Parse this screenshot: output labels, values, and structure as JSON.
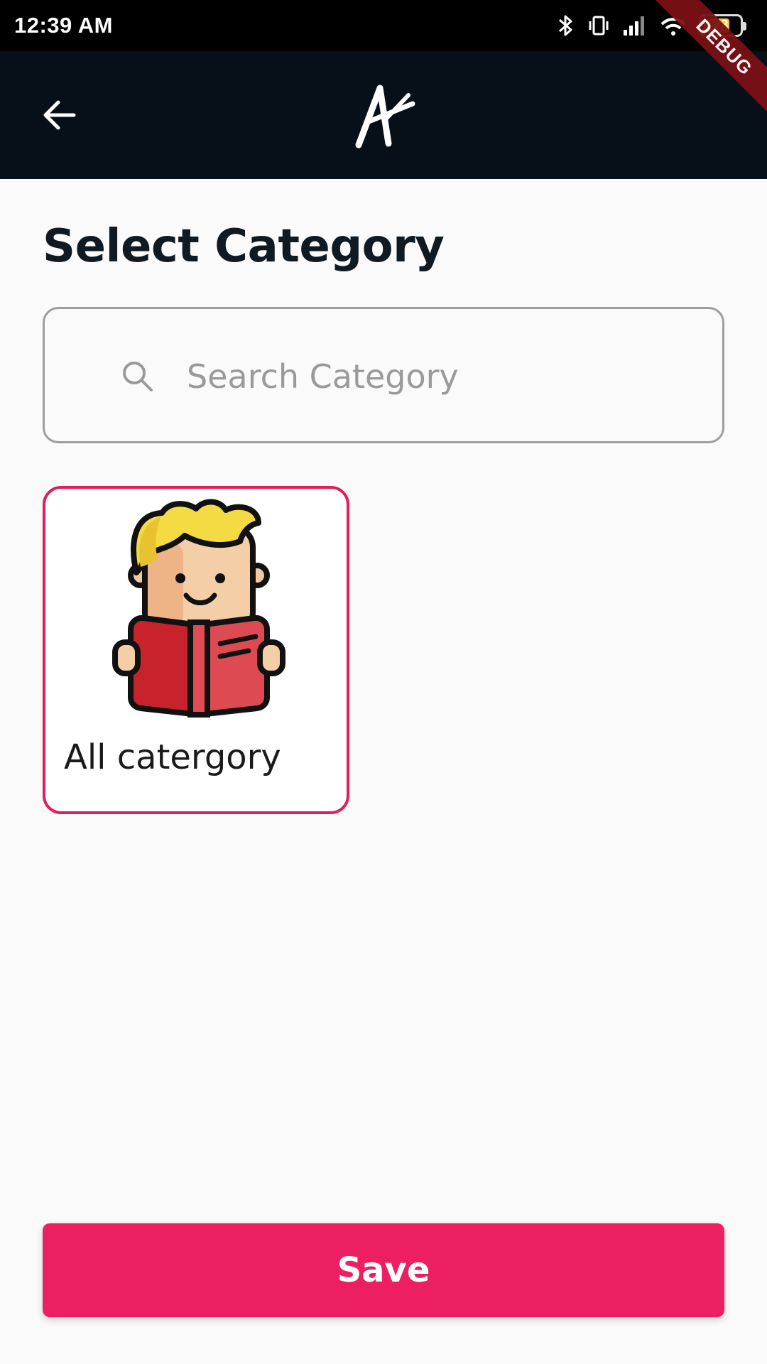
{
  "status_bar": {
    "time": "12:39 AM",
    "battery_level": "73",
    "battery_fraction": 0.73,
    "icons": [
      "bluetooth-icon",
      "vibrate-icon",
      "signal-icon",
      "wifi-icon",
      "battery-icon"
    ]
  },
  "debug_banner": "DEBUG",
  "app_bar": {
    "back_icon": "arrow-left-icon",
    "logo": "A",
    "background": "#071018"
  },
  "page": {
    "title": "Select Category"
  },
  "search": {
    "placeholder": "Search Category",
    "value": ""
  },
  "categories": [
    {
      "label": "All catergory",
      "selected": true,
      "icon": "boy-reading-book-illustration"
    }
  ],
  "save_button": {
    "label": "Save",
    "color": "#ec1f62"
  },
  "colors": {
    "accent": "#ec1f62",
    "selected_border": "#e01e5a"
  }
}
